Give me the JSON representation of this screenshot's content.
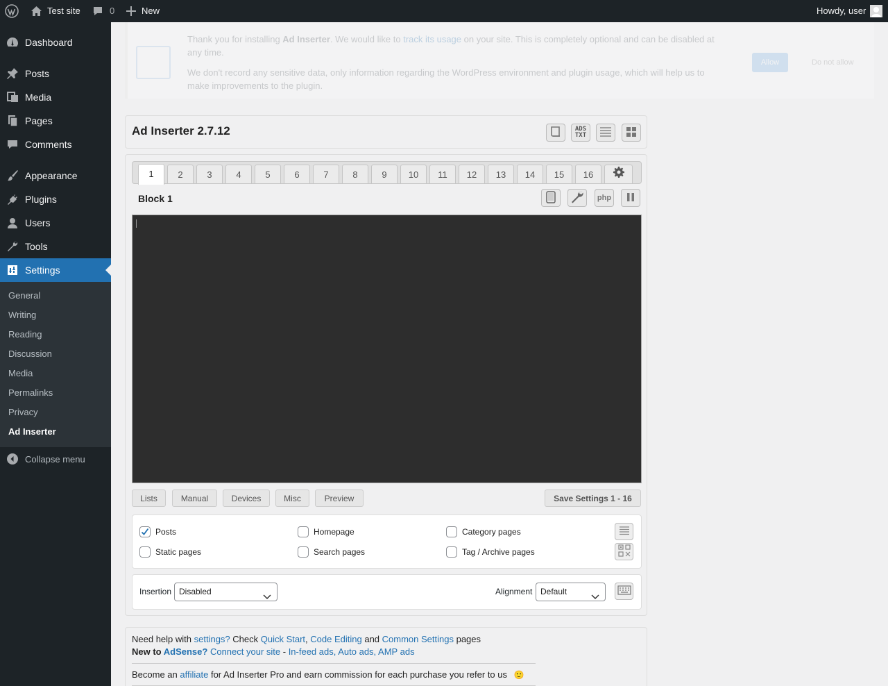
{
  "adminbar": {
    "site_name": "Test site",
    "comments_count": "0",
    "new_label": "New",
    "howdy": "Howdy, user"
  },
  "sidebar": {
    "items": [
      {
        "label": "Dashboard",
        "icon": "dashboard-icon"
      },
      {
        "label": "Posts",
        "icon": "pin-icon"
      },
      {
        "label": "Media",
        "icon": "media-icon"
      },
      {
        "label": "Pages",
        "icon": "pages-icon"
      },
      {
        "label": "Comments",
        "icon": "comments-icon"
      },
      {
        "label": "Appearance",
        "icon": "brush-icon"
      },
      {
        "label": "Plugins",
        "icon": "plug-icon"
      },
      {
        "label": "Users",
        "icon": "users-icon"
      },
      {
        "label": "Tools",
        "icon": "wrench-icon"
      },
      {
        "label": "Settings",
        "icon": "settings-icon"
      }
    ],
    "submenu": [
      "General",
      "Writing",
      "Reading",
      "Discussion",
      "Media",
      "Permalinks",
      "Privacy",
      "Ad Inserter"
    ],
    "collapse_label": "Collapse menu"
  },
  "notice": {
    "p1_a": "Thank you for installing ",
    "p1_b": "Ad Inserter",
    "p1_c": ". We would like to ",
    "p1_link": "track its usage",
    "p1_d": " on your site. This is completely optional and can be disabled at any time.",
    "p2": "We don't record any sensitive data, only information regarding the WordPress environment and plugin usage, which will help us to make improvements to the plugin.",
    "allow": "Allow",
    "dont": "Do not allow"
  },
  "header": {
    "title": "Ad Inserter 2.7.12",
    "ads_txt_top": "ADS",
    "ads_txt_bottom": "TXT"
  },
  "tabs": [
    "1",
    "2",
    "3",
    "4",
    "5",
    "6",
    "7",
    "8",
    "9",
    "10",
    "11",
    "12",
    "13",
    "14",
    "15",
    "16"
  ],
  "block": {
    "title": "Block 1",
    "php_label": "php"
  },
  "buttons": {
    "lists": "Lists",
    "manual": "Manual",
    "devices": "Devices",
    "misc": "Misc",
    "preview": "Preview",
    "save": "Save Settings 1 - 16"
  },
  "page_types": {
    "posts": "Posts",
    "homepage": "Homepage",
    "category": "Category pages",
    "static": "Static pages",
    "search": "Search pages",
    "tag": "Tag / Archive pages"
  },
  "insertion": {
    "label": "Insertion",
    "value": "Disabled",
    "alignment_label": "Alignment",
    "alignment_value": "Default"
  },
  "help": {
    "l1_a": "Need help with ",
    "l1_settings": "settings?",
    "l1_b": " Check ",
    "l1_qs": "Quick Start",
    "l1_comma": ", ",
    "l1_ce": "Code Editing",
    "l1_and": " and ",
    "l1_cs": "Common Settings",
    "l1_pages": " pages",
    "l2_new": "New to ",
    "l2_adsense": "AdSense?",
    "l2_connect": "Connect your site",
    "l2_dash": " - ",
    "l2_ads": "In-feed ads, Auto ads, AMP ads",
    "l3_a": "Become an ",
    "l3_aff": "affiliate",
    "l3_b": " for Ad Inserter Pro and earn commission for each purchase you refer to us",
    "smiley": "🙂"
  },
  "colors": {
    "admin_bg": "#1d2327",
    "accent": "#2271b1",
    "editor_bg": "#2d2d2d"
  }
}
